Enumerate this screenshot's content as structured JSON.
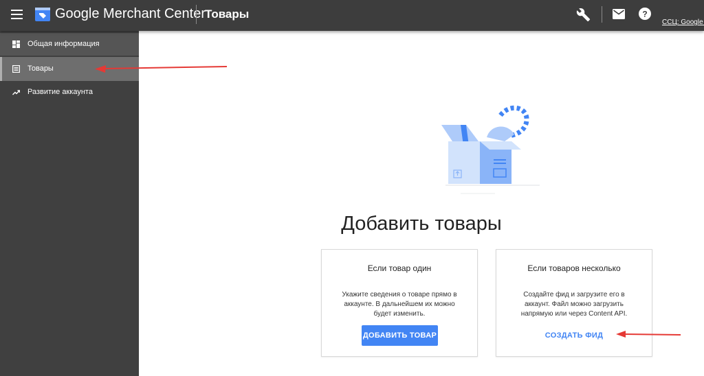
{
  "header": {
    "app_name": "Google Merchant Center",
    "page_title": "Товары",
    "account_label": "ССЦ: Google S"
  },
  "sidebar": {
    "items": [
      {
        "label": "Общая информация",
        "icon": "dashboard-icon",
        "selected": false
      },
      {
        "label": "Товары",
        "icon": "list-icon",
        "selected": true
      },
      {
        "label": "Развитие аккаунта",
        "icon": "trending-up-icon",
        "selected": false
      }
    ]
  },
  "main": {
    "heading": "Добавить товары",
    "cards": [
      {
        "title": "Если товар один",
        "description": "Укажите сведения о товаре прямо в аккаунте. В дальнейшем их можно будет изменить.",
        "action_label": "ДОБАВИТЬ ТОВАР"
      },
      {
        "title": "Если товаров несколько",
        "description": "Создайте фид и загрузите его в аккаунт. Файл можно загрузить напрямую или через Content API.",
        "action_label": "СОЗДАТЬ ФИД"
      }
    ]
  },
  "colors": {
    "topbar": "#3d3d3d",
    "sidebar": "#404040",
    "accent": "#4285f4",
    "annotation_arrow": "#e53935"
  }
}
